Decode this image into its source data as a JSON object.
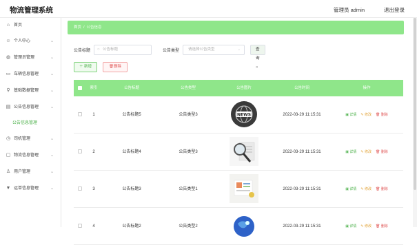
{
  "header": {
    "app_title": "物流管理系统",
    "admin_label": "管理员 admin",
    "logout_label": "退出登录"
  },
  "sidebar": {
    "items": [
      {
        "label": "首页",
        "icon": "home-icon",
        "glyph": "⌂",
        "chevron": false
      },
      {
        "label": "个人中心",
        "icon": "user-icon",
        "glyph": "☺",
        "chevron": true
      },
      {
        "label": "管理员管理",
        "icon": "admin-icon",
        "glyph": "◍",
        "chevron": true
      },
      {
        "label": "车辆信息管理",
        "icon": "truck-icon",
        "glyph": "▭",
        "chevron": true
      },
      {
        "label": "基础数据管理",
        "icon": "location-icon",
        "glyph": "⚲",
        "chevron": true
      },
      {
        "label": "公告信息管理",
        "icon": "notice-icon",
        "glyph": "▤",
        "chevron": true
      },
      {
        "label": "公告信息管理",
        "icon": "",
        "glyph": "",
        "chevron": false,
        "sub": true
      },
      {
        "label": "司机管理",
        "icon": "driver-icon",
        "glyph": "◷",
        "chevron": true
      },
      {
        "label": "物流信息管理",
        "icon": "chat-icon",
        "glyph": "▢",
        "chevron": true
      },
      {
        "label": "用户管理",
        "icon": "users-icon",
        "glyph": "♙",
        "chevron": true
      },
      {
        "label": "运单信息管理",
        "icon": "bill-icon",
        "glyph": "▼",
        "chevron": true
      }
    ]
  },
  "breadcrumb": {
    "home": "首页",
    "separator": "/",
    "current": "公告信息"
  },
  "filter": {
    "title_label": "公告标题",
    "title_placeholder": "公告标题",
    "type_label": "公告类型",
    "type_placeholder": "请选择公告类型",
    "query_label": "查询"
  },
  "toolbar": {
    "add_label": "＋ 新增",
    "delete_label": "删除"
  },
  "table": {
    "headers": [
      "",
      "索引",
      "公告标题",
      "公告类型",
      "公告图片",
      "公告时间",
      "操作"
    ],
    "rows": [
      {
        "index": "1",
        "title": "公告标题5",
        "type": "公告类型3",
        "image": "news-globe-image",
        "time": "2022-03-29 11:15:31"
      },
      {
        "index": "2",
        "title": "公告标题4",
        "type": "公告类型3",
        "image": "magnifier-docs-image",
        "time": "2022-03-29 11:15:31"
      },
      {
        "index": "3",
        "title": "公告标题3",
        "type": "公告类型1",
        "image": "paper-notes-image",
        "time": "2022-03-29 11:15:31"
      },
      {
        "index": "4",
        "title": "公告标题2",
        "type": "公告类型2",
        "image": "earth-image",
        "time": "2022-03-29 11:15:31"
      }
    ],
    "op_detail": "详情",
    "op_modify": "修改",
    "op_remove": "删除"
  },
  "colors": {
    "accent": "#8fe68a",
    "active_text": "#4cb14a",
    "danger": "#e05555",
    "warning": "#e2a43a"
  }
}
